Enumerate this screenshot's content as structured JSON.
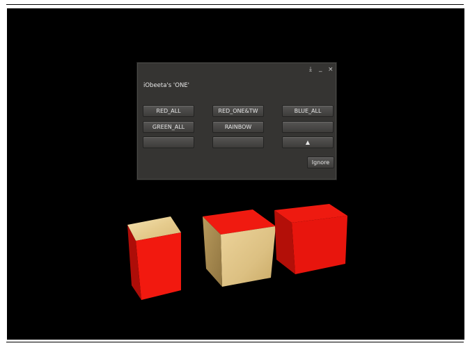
{
  "dialog": {
    "title": "iObeeta's 'ONE'",
    "buttons": {
      "red_all": "RED_ALL",
      "red_one_tw": "RED_ONE&TW",
      "blue_all": "BLUE_ALL",
      "green_all": "GREEN_ALL",
      "rainbow": "RAINBOW",
      "empty": "",
      "up_arrow": "▲",
      "ignore": "Ignore"
    },
    "titlebar_icons": [
      "download-icon",
      "minimize-icon",
      "close-icon"
    ]
  },
  "scene": {
    "objects": [
      "cube-left",
      "cube-middle",
      "cube-right"
    ],
    "colors": {
      "red": "#f01a12",
      "wood": "#e8cc8c",
      "background": "#000000"
    }
  }
}
